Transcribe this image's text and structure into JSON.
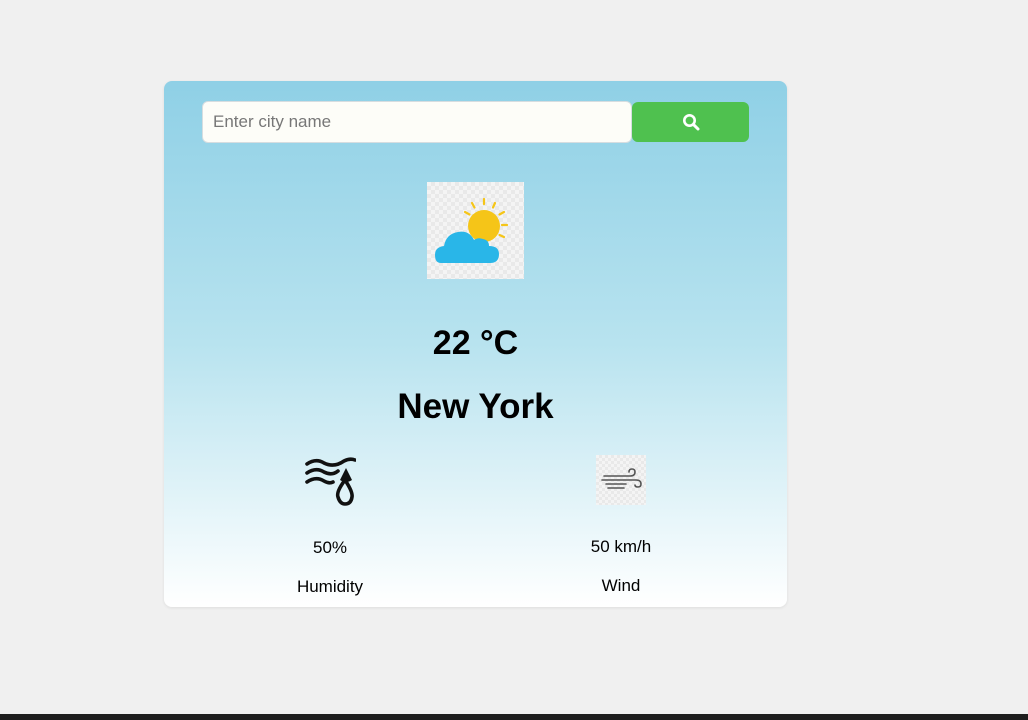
{
  "search": {
    "placeholder": "Enter city name",
    "value": "",
    "button_icon": "search-icon"
  },
  "weather": {
    "icon": "partly-cloudy-icon",
    "temperature": "22 °C",
    "city": "New York"
  },
  "details": {
    "humidity": {
      "icon": "humidity-icon",
      "value": "50%",
      "label": "Humidity"
    },
    "wind": {
      "icon": "wind-icon",
      "value": "50 km/h",
      "label": "Wind"
    }
  },
  "colors": {
    "button": "#4fc14f",
    "card_top": "#8fd0e6",
    "card_bottom": "#ffffff",
    "sun": "#f5c518",
    "cloud": "#29b6e8"
  }
}
